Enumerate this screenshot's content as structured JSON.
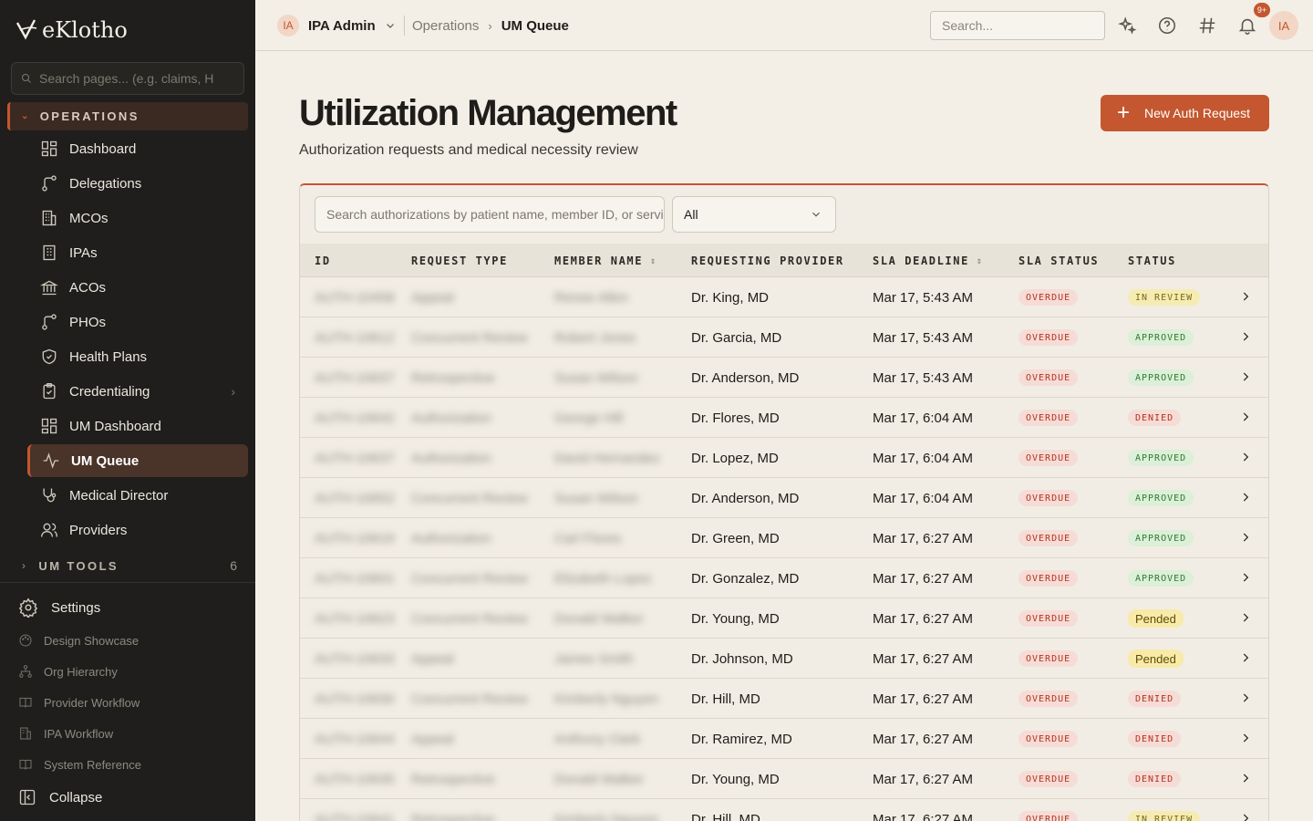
{
  "brand": {
    "name": "eKlotho",
    "accent": "#c4572f"
  },
  "sidebar": {
    "search_placeholder": "Search pages... (e.g. claims, H",
    "section_label": "OPERATIONS",
    "items": [
      {
        "label": "Dashboard",
        "icon": "dashboard-icon"
      },
      {
        "label": "Delegations",
        "icon": "workflow-icon"
      },
      {
        "label": "MCOs",
        "icon": "building-icon"
      },
      {
        "label": "IPAs",
        "icon": "office-icon"
      },
      {
        "label": "ACOs",
        "icon": "landmark-icon"
      },
      {
        "label": "PHOs",
        "icon": "workflow-icon"
      },
      {
        "label": "Health Plans",
        "icon": "shield-icon"
      },
      {
        "label": "Credentialing",
        "icon": "clipboard-icon"
      },
      {
        "label": "UM Dashboard",
        "icon": "dashboard-icon"
      },
      {
        "label": "UM Queue",
        "icon": "activity-icon"
      },
      {
        "label": "Medical Director",
        "icon": "stethoscope-icon"
      },
      {
        "label": "Providers",
        "icon": "users-icon"
      }
    ],
    "tools_label": "UM TOOLS",
    "tools_count": "6",
    "settings_label": "Settings",
    "links": [
      {
        "label": "Design Showcase",
        "icon": "palette-icon"
      },
      {
        "label": "Org Hierarchy",
        "icon": "hierarchy-icon"
      },
      {
        "label": "Provider Workflow",
        "icon": "book-icon"
      },
      {
        "label": "IPA Workflow",
        "icon": "building-icon"
      },
      {
        "label": "System Reference",
        "icon": "book-icon"
      }
    ],
    "collapse_label": "Collapse"
  },
  "topbar": {
    "org_initials": "IA",
    "org_name": "IPA Admin",
    "breadcrumb": [
      "Operations",
      "UM Queue"
    ],
    "search_placeholder": "Search...",
    "notification_badge": "9+",
    "user_initials": "IA"
  },
  "page": {
    "title": "Utilization Management",
    "subtitle": "Authorization requests and medical necessity review",
    "new_button": "New Auth Request"
  },
  "filters": {
    "search_placeholder": "Search authorizations by patient name, member ID, or service",
    "status_selected": "All"
  },
  "table": {
    "columns": [
      "ID",
      "REQUEST TYPE",
      "MEMBER NAME",
      "REQUESTING PROVIDER",
      "SLA DEADLINE",
      "SLA STATUS",
      "STATUS"
    ],
    "rows": [
      {
        "id": "AUTH-10458",
        "type": "Appeal",
        "member": "Renee Allen",
        "provider": "Dr. King, MD",
        "deadline": "Mar 17, 5:43 AM",
        "sla": "OVERDUE",
        "status": "IN REVIEW"
      },
      {
        "id": "AUTH-10612",
        "type": "Concurrent Review",
        "member": "Robert Jones",
        "provider": "Dr. Garcia, MD",
        "deadline": "Mar 17, 5:43 AM",
        "sla": "OVERDUE",
        "status": "APPROVED"
      },
      {
        "id": "AUTH-10637",
        "type": "Retrospective",
        "member": "Susan Wilson",
        "provider": "Dr. Anderson, MD",
        "deadline": "Mar 17, 5:43 AM",
        "sla": "OVERDUE",
        "status": "APPROVED"
      },
      {
        "id": "AUTH-10642",
        "type": "Authorization",
        "member": "George Hill",
        "provider": "Dr. Flores, MD",
        "deadline": "Mar 17, 6:04 AM",
        "sla": "OVERDUE",
        "status": "DENIED"
      },
      {
        "id": "AUTH-10637",
        "type": "Authorization",
        "member": "David Hernandez",
        "provider": "Dr. Lopez, MD",
        "deadline": "Mar 17, 6:04 AM",
        "sla": "OVERDUE",
        "status": "APPROVED"
      },
      {
        "id": "AUTH-10652",
        "type": "Concurrent Review",
        "member": "Susan Wilson",
        "provider": "Dr. Anderson, MD",
        "deadline": "Mar 17, 6:04 AM",
        "sla": "OVERDUE",
        "status": "APPROVED"
      },
      {
        "id": "AUTH-10619",
        "type": "Authorization",
        "member": "Carl Flores",
        "provider": "Dr. Green, MD",
        "deadline": "Mar 17, 6:27 AM",
        "sla": "OVERDUE",
        "status": "APPROVED"
      },
      {
        "id": "AUTH-10601",
        "type": "Concurrent Review",
        "member": "Elizabeth Lopez",
        "provider": "Dr. Gonzalez, MD",
        "deadline": "Mar 17, 6:27 AM",
        "sla": "OVERDUE",
        "status": "APPROVED"
      },
      {
        "id": "AUTH-10623",
        "type": "Concurrent Review",
        "member": "Donald Walker",
        "provider": "Dr. Young, MD",
        "deadline": "Mar 17, 6:27 AM",
        "sla": "OVERDUE",
        "status": "Pended"
      },
      {
        "id": "AUTH-10633",
        "type": "Appeal",
        "member": "James Smith",
        "provider": "Dr. Johnson, MD",
        "deadline": "Mar 17, 6:27 AM",
        "sla": "OVERDUE",
        "status": "Pended"
      },
      {
        "id": "AUTH-10630",
        "type": "Concurrent Review",
        "member": "Kimberly Nguyen",
        "provider": "Dr. Hill, MD",
        "deadline": "Mar 17, 6:27 AM",
        "sla": "OVERDUE",
        "status": "DENIED"
      },
      {
        "id": "AUTH-10644",
        "type": "Appeal",
        "member": "Anthony Clark",
        "provider": "Dr. Ramirez, MD",
        "deadline": "Mar 17, 6:27 AM",
        "sla": "OVERDUE",
        "status": "DENIED"
      },
      {
        "id": "AUTH-10635",
        "type": "Retrospective",
        "member": "Donald Walker",
        "provider": "Dr. Young, MD",
        "deadline": "Mar 17, 6:27 AM",
        "sla": "OVERDUE",
        "status": "DENIED"
      },
      {
        "id": "AUTH-10641",
        "type": "Retrospective",
        "member": "Kimberly Nguyen",
        "provider": "Dr. Hill, MD",
        "deadline": "Mar 17, 6:27 AM",
        "sla": "OVERDUE",
        "status": "IN REVIEW"
      }
    ]
  }
}
